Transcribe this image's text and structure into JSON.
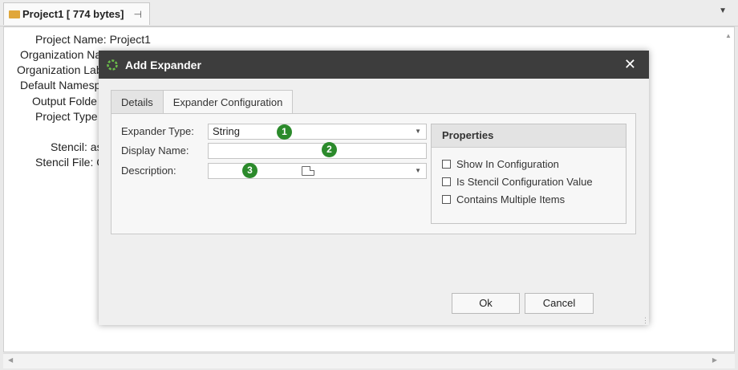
{
  "tab": {
    "title": "Project1 [ 774 bytes]",
    "pin_icon": "pin-icon"
  },
  "doc": {
    "rows": [
      "Project Name: Project1",
      "Organization Na",
      "Organization Lab",
      "Default Namesp",
      "Output Folde",
      "Project Type",
      "Stencil: as",
      "Stencil File: C"
    ]
  },
  "modal": {
    "title": "Add Expander",
    "close": "✕",
    "tabs": [
      "Details",
      "Expander Configuration"
    ],
    "labels": {
      "expander_type": "Expander Type:",
      "display_name": "Display Name:",
      "description": "Description:"
    },
    "expander_type_value": "String",
    "display_name_value": "",
    "description_value": "",
    "badges": [
      "1",
      "2",
      "3"
    ],
    "properties": {
      "header": "Properties",
      "items": [
        "Show In Configuration",
        "Is Stencil Configuration Value",
        "Contains Multiple Items"
      ]
    },
    "ok": "Ok",
    "cancel": "Cancel"
  },
  "colors": {
    "header_bg": "#3d3d3d",
    "badge": "#2b8a2b",
    "logo": "#6cc04a"
  }
}
